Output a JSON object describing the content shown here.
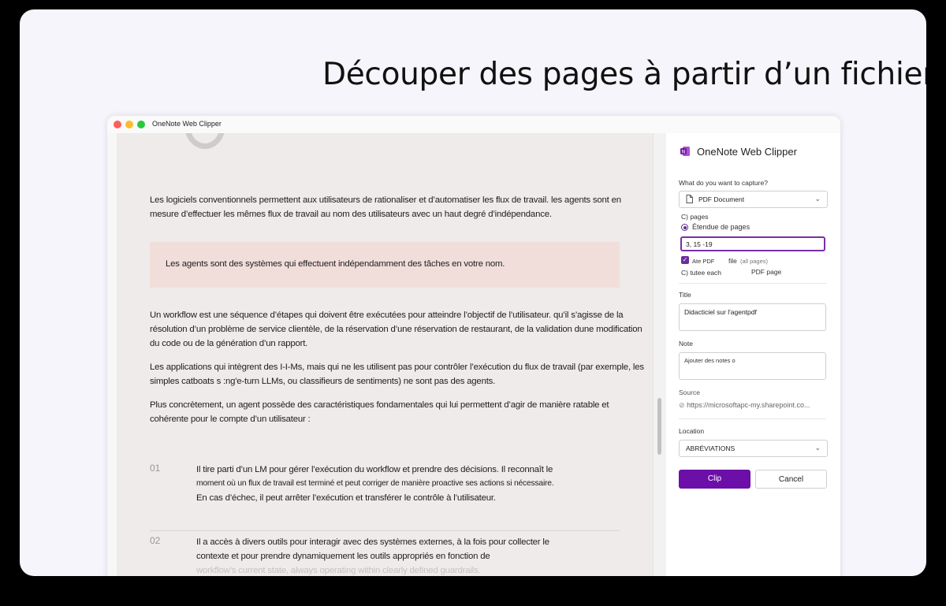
{
  "headline": "Découper des pages à partir d’un fichier PDF",
  "window": {
    "title": "OneNote Web Clipper"
  },
  "doc": {
    "para1": "Les logiciels conventionnels permettent aux utilisateurs de rationaliser et d’automatiser les flux de travail. les agents sont en mesure d’effectuer les mêmes flux de travail au nom des utilisateurs avec un haut degré d’indépendance.",
    "callout": "Les agents sont des systèmes qui effectuent indépendamment des tâches en votre nom.",
    "para2": "Un workflow est une séquence d’étapes qui doivent être exécutées pour atteindre l’objectif de l’utilisateur. qu’il s’agisse de la résolution d’un problème de service clientèle, de la réservation d’une réservation de restaurant, de la validation dune modification du code ou de la génération d’un rapport.",
    "para3": "Les applications qui intègrent des I-I-Ms, mais qui ne les utilisent pas pour contrôler l’exécution du flux de travail (par exemple, les simples catboats s :ng'e-turn LLMs, ou classifieurs de sentiments) ne sont pas des agents.",
    "para4": "Plus concrètement, un agent possède des caractéristiques fondamentales qui lui permettent d’agir de manière ratable et cohérente pour le compte d’un utilisateur :",
    "items": [
      {
        "num": "01",
        "line1": "Il tire parti d’un LM pour gérer l’exécution du workflow et prendre des décisions. Il reconnaît le",
        "line2": "moment où un flux de travail est terminé et peut corriger de manière proactive ses actions si nécessaire.",
        "line3": "En cas d’échec, il peut arrêter l’exécution et transférer le contrôle à l’utilisateur."
      },
      {
        "num": "02",
        "line1": "Il a accès à divers outils pour interagir avec des systèmes externes, à la fois pour collecter le",
        "line2": "contexte et pour prendre dynamiquement les outils appropriés en fonction de",
        "line3": "workflow’s current state, always operating within clearly defined guardrails."
      }
    ]
  },
  "panel": {
    "title": "OneNote Web Clipper",
    "capture_label": "What do you want to capture?",
    "capture_value": "PDF Document",
    "opt_pages": "C) pages",
    "opt_range": "Étendue de pages",
    "range_value": "3, 15 -19",
    "attach_a": "Ate PDF",
    "attach_b": "file",
    "attach_c": "(all pages)",
    "each_a": "C) tutee each",
    "each_b": "PDF page",
    "title_label": "Title",
    "title_value": "Didacticiel sur l'agentpdf",
    "note_label": "Note",
    "note_placeholder": "Ajouter des notes o",
    "source_label": "Source",
    "source_value": "https://microsoftapc-my.sharepoint.co...",
    "location_label": "Location",
    "location_value": "ABRÉVIATIONS",
    "clip_label": "Clip",
    "cancel_label": "Cancel"
  }
}
